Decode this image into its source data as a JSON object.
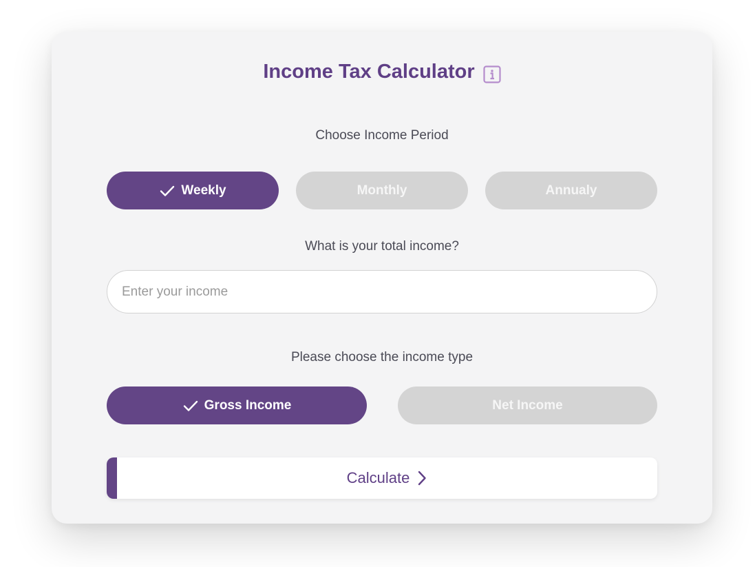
{
  "app": {
    "title": "Income Tax Calculator",
    "info_icon": "info-icon"
  },
  "colors": {
    "accent": "#634586",
    "title": "#5f3f86",
    "inactive_pill": "#d4d4d4",
    "card_bg": "#f4f4f5"
  },
  "period": {
    "label": "Choose Income Period",
    "options": [
      {
        "label": "Weekly",
        "selected": true
      },
      {
        "label": "Monthly",
        "selected": false
      },
      {
        "label": "Annualy",
        "selected": false
      }
    ]
  },
  "income": {
    "label": "What is your total income?",
    "placeholder": "Enter your income",
    "value": ""
  },
  "income_type": {
    "label": "Please choose the income type",
    "options": [
      {
        "label": "Gross Income",
        "selected": true
      },
      {
        "label": "Net Income",
        "selected": false
      }
    ]
  },
  "calculate": {
    "label": "Calculate",
    "icon": "chevron-right-icon"
  }
}
